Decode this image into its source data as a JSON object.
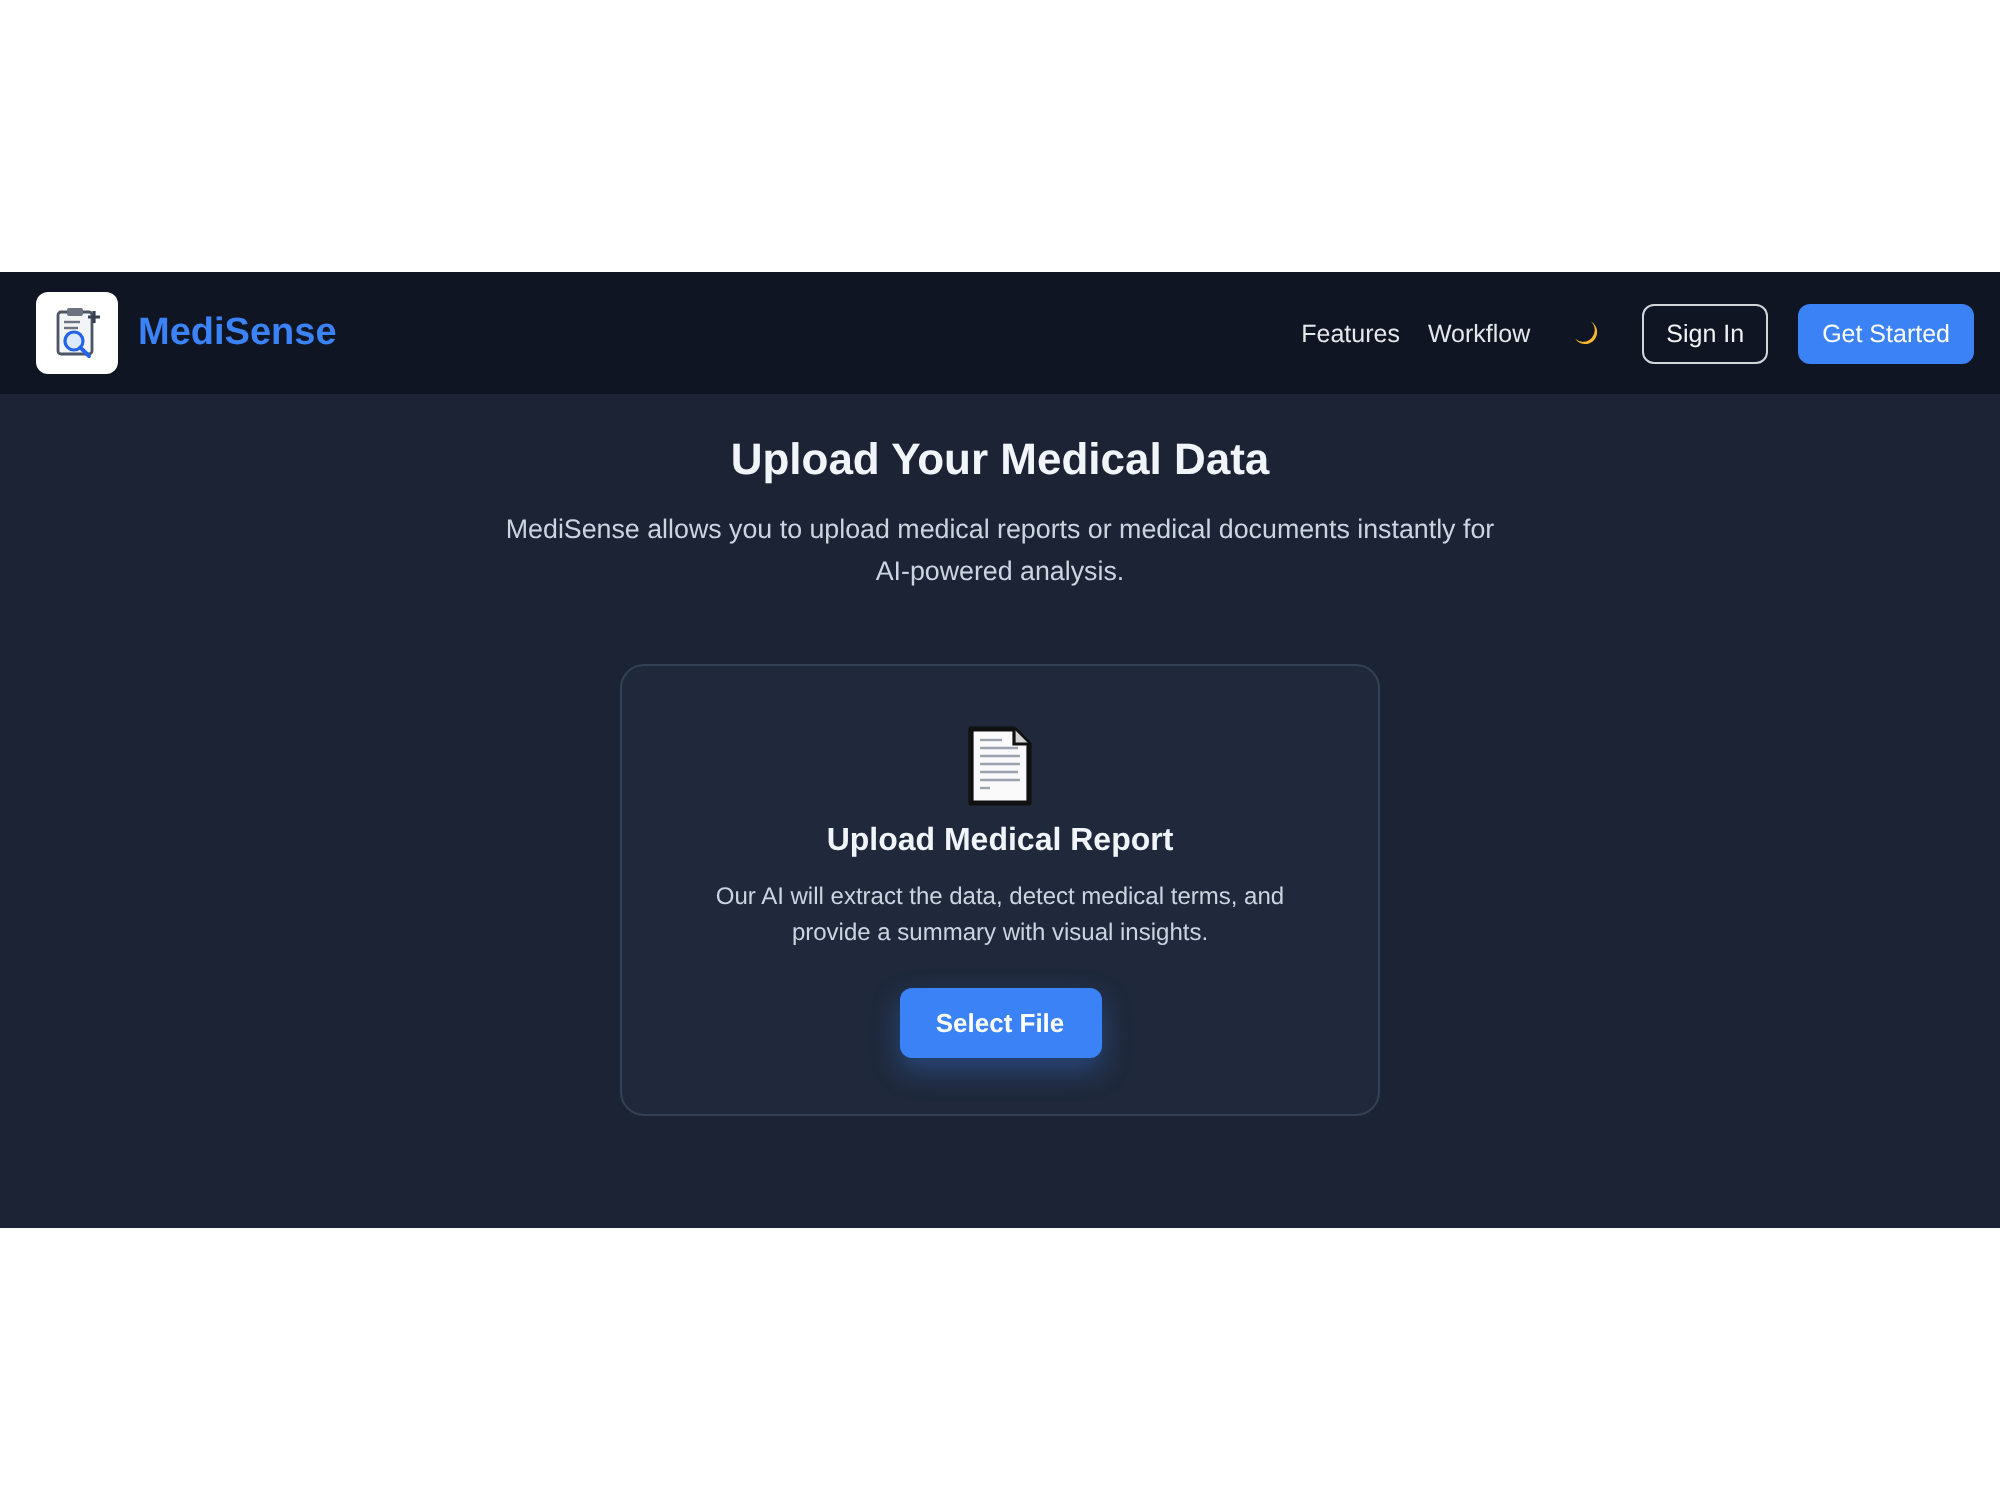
{
  "header": {
    "logo_text": "MediSense",
    "nav_links": [
      "Features",
      "Workflow"
    ],
    "buttons": [
      {
        "label": "Sign In",
        "kind": "outline"
      },
      {
        "label": "Get Started",
        "kind": "primary"
      }
    ]
  },
  "hero": {
    "title": "Upload Your Medical Data",
    "subtitle": "MediSense allows you to upload medical reports or medical documents instantly for AI-powered analysis."
  },
  "upload_card": {
    "title": "Upload Medical Report",
    "description": "Our AI will extract the data, detect medical terms, and provide a summary with visual insights.",
    "button": "Select File"
  }
}
